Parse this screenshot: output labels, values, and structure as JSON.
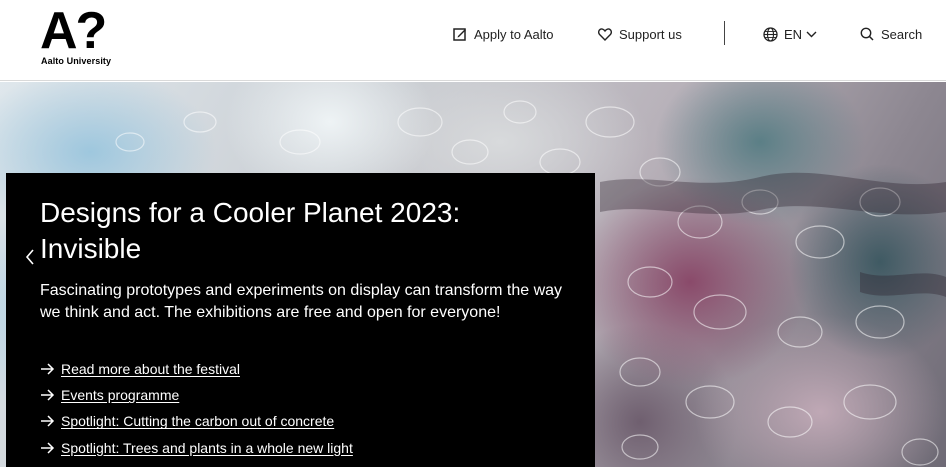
{
  "header": {
    "logo": {
      "mark": "A?",
      "name": "Aalto University"
    },
    "nav": {
      "apply_label": "Apply to Aalto",
      "support_label": "Support us",
      "language_label": "EN",
      "search_label": "Search"
    }
  },
  "hero": {
    "title": "Designs for a Cooler Planet 2023: Invisible",
    "description": "Fascinating prototypes and experiments on display can transform the way we think and act. The exhibitions are free and open for everyone!",
    "links": [
      {
        "label": "Read more about the festival"
      },
      {
        "label": "Events programme"
      },
      {
        "label": "Spotlight: Cutting the carbon out of concrete"
      },
      {
        "label": "Spotlight: Trees and plants in a whole new light"
      }
    ]
  },
  "icons": {
    "apply": "edit-square-icon",
    "support": "heart-icon",
    "language": "globe-icon",
    "language_chevron": "chevron-down-icon",
    "search": "search-icon",
    "link": "arrow-right-icon",
    "carousel_prev": "chevron-left-icon"
  }
}
